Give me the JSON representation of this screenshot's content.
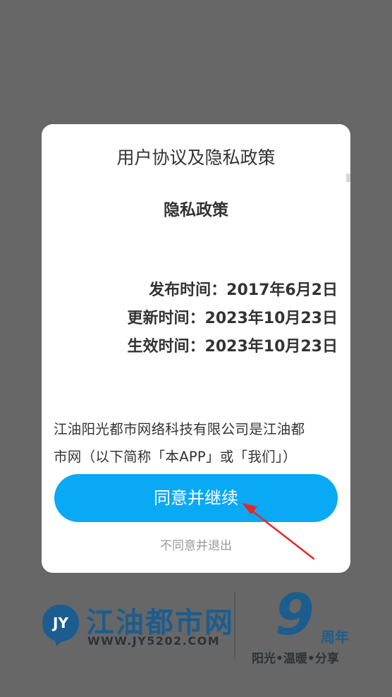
{
  "dialog": {
    "title": "用户协议及隐私政策",
    "policy_heading": "隐私政策",
    "dates": [
      "发布时间：2017年6月2日",
      "更新时间：2023年10月23日",
      "生效时间：2023年10月23日"
    ],
    "intro_lines": [
      "江油阳光都市网络科技有限公司是江油都",
      "市网（以下简称「本APP」或「我们」）"
    ],
    "agree_label": "同意并继续",
    "decline_label": "不同意并退出"
  },
  "brand": {
    "name_cn": "江油都市网",
    "url": "WWW.JY5202.COM",
    "logo_text": "JY",
    "anniversary_number": "9",
    "anniversary_label": "周年",
    "slogan": "阳光•温暖•分享"
  },
  "colors": {
    "overlay": "#676767",
    "primary_button": "#09a9f5",
    "brand_blue": "#1b5d8f",
    "annotation_arrow": "#e8262a"
  },
  "icons": {
    "logo": "speech-bubble-logo",
    "annotation": "red-arrow-icon"
  }
}
